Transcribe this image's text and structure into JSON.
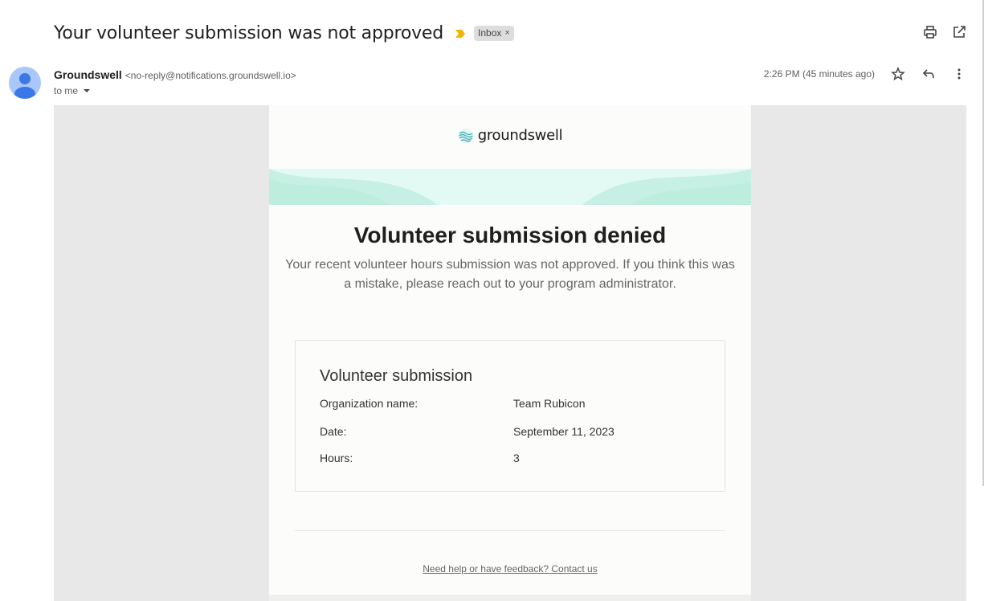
{
  "header": {
    "subject": "Your volunteer submission was not approved",
    "label": "Inbox",
    "label_remove": "×"
  },
  "actions": {
    "print_icon": "print-icon",
    "open_new_window_icon": "open-in-new-window-icon"
  },
  "sender": {
    "name": "Groundswell",
    "email": "<no-reply@notifications.groundswell.io>",
    "to": "to me"
  },
  "meta": {
    "timestamp": "2:26 PM (45 minutes ago)"
  },
  "email": {
    "brand": "groundswell",
    "heading": "Volunteer submission denied",
    "intro": "Your recent volunteer hours submission was not approved. If you think this was a mistake, please reach out to your program administrator.",
    "details": {
      "title": "Volunteer submission",
      "rows": [
        {
          "label": "Organization name:",
          "value": "Team Rubicon"
        },
        {
          "label": "Date:",
          "value": "September 11, 2023"
        },
        {
          "label": "Hours:",
          "value": "3"
        }
      ]
    },
    "footer_link": "Need help or have feedback? Contact us"
  },
  "colors": {
    "importance_marker": "#f4b400",
    "avatar_bg": "#a8c7fa",
    "avatar_fg": "#3b78e7",
    "wave_light": "#e3faf4",
    "wave_mid": "#c6f0e3"
  }
}
